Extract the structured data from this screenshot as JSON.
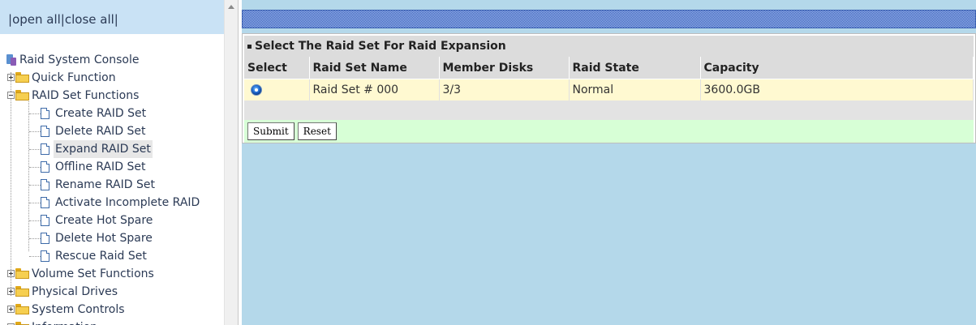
{
  "sidebar": {
    "toplinks": {
      "sep1": "|",
      "open_all": "open all",
      "sep2": "|",
      "close_all": "close all",
      "sep3": "|"
    },
    "root": {
      "label": "Raid System Console"
    },
    "quick_function": {
      "label": "Quick Function"
    },
    "raid_set_functions": {
      "label": "RAID Set Functions",
      "items": [
        {
          "label": "Create RAID Set"
        },
        {
          "label": "Delete RAID Set"
        },
        {
          "label": "Expand RAID Set"
        },
        {
          "label": "Offline RAID Set"
        },
        {
          "label": "Rename RAID Set"
        },
        {
          "label": "Activate Incomplete RAID"
        },
        {
          "label": "Create Hot Spare"
        },
        {
          "label": "Delete Hot Spare"
        },
        {
          "label": "Rescue Raid Set"
        }
      ]
    },
    "folders": [
      {
        "label": "Volume Set Functions"
      },
      {
        "label": "Physical Drives"
      },
      {
        "label": "System Controls"
      },
      {
        "label": "Information"
      }
    ]
  },
  "main": {
    "section_title": "Select The Raid Set For Raid Expansion",
    "columns": [
      "Select",
      "Raid Set Name",
      "Member Disks",
      "Raid State",
      "Capacity"
    ],
    "rows": [
      {
        "raid_set_name": "Raid Set # 000",
        "member_disks": "3/3",
        "raid_state": "Normal",
        "capacity": "3600.0GB",
        "selected": true
      }
    ],
    "submit_label": "Submit",
    "reset_label": "Reset"
  },
  "colors": {
    "main_bg": "#b4d8ea",
    "row_highlight": "#fff9d1",
    "button_row_bg": "#d7ffd6",
    "banner": "#2f56b8"
  }
}
